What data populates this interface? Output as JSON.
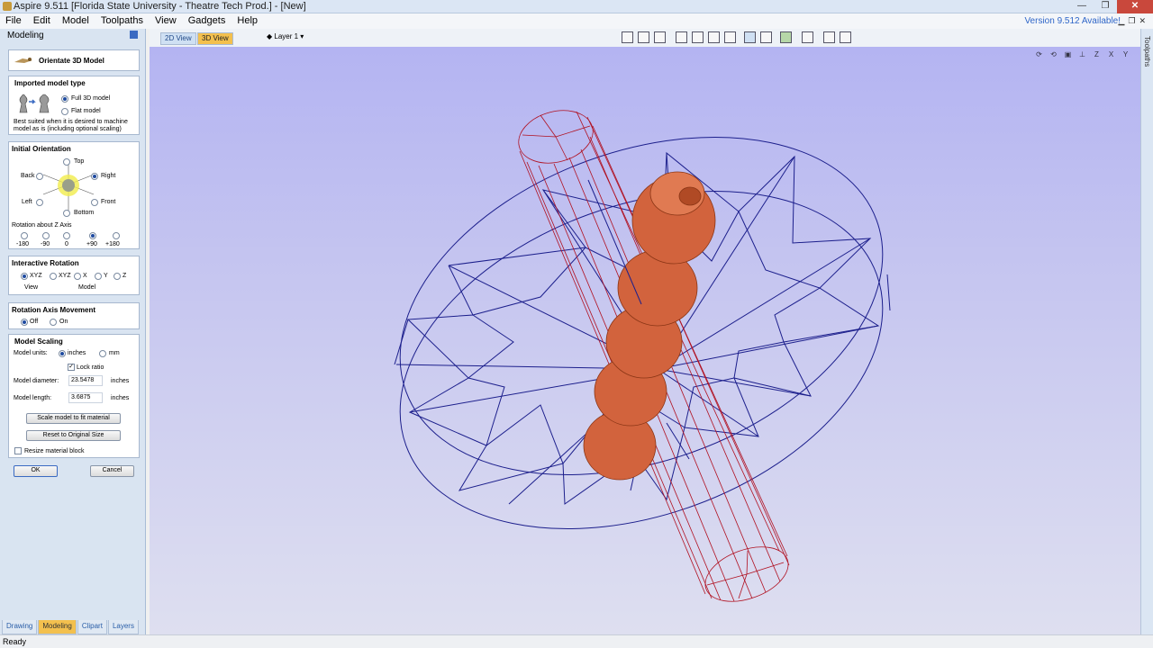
{
  "window": {
    "title": "Aspire 9.511 [Florida State University - Theatre Tech Prod.] - [New]"
  },
  "menu": {
    "items": [
      "File",
      "Edit",
      "Model",
      "Toolpaths",
      "View",
      "Gadgets",
      "Help"
    ],
    "version_notice": "Version 9.512 Available!"
  },
  "panel": {
    "header": "Modeling",
    "title": "Orientate 3D Model",
    "imported_type": {
      "title": "Imported model type",
      "full": "Full 3D model",
      "flat": "Flat model",
      "desc_line1": "Best suited when it is desired to machine",
      "desc_line2": "model as is (including optional scaling)"
    },
    "orientation": {
      "title": "Initial Orientation",
      "top": "Top",
      "back": "Back",
      "right": "Right",
      "left": "Left",
      "front": "Front",
      "bottom": "Bottom",
      "z_title": "Rotation about Z Axis",
      "z_values": [
        "-180",
        "-90",
        "0",
        "+90",
        "+180"
      ]
    },
    "interactive": {
      "title": "Interactive Rotation",
      "xyz_view": "XYZ",
      "xyz_model": "XYZ",
      "x": "X",
      "y": "Y",
      "z": "Z",
      "view_label": "View",
      "model_label": "Model"
    },
    "axis_movement": {
      "title": "Rotation Axis Movement",
      "off": "Off",
      "on": "On"
    },
    "scaling": {
      "title": "Model Scaling",
      "units_label": "Model units:",
      "inches": "inches",
      "mm": "mm",
      "lock": "Lock ratio",
      "diameter_label": "Model diameter:",
      "diameter_value": "23.5478",
      "diameter_unit": "inches",
      "length_label": "Model length:",
      "length_value": "3.6875",
      "length_unit": "inches",
      "scale_btn": "Scale model to fit material",
      "reset_btn": "Reset to Original Size",
      "resize": "Resize material block"
    },
    "ok": "OK",
    "cancel": "Cancel"
  },
  "bottom_tabs": [
    "Drawing",
    "Modeling",
    "Clipart",
    "Layers"
  ],
  "toolbar": {
    "tab_2d": "2D View",
    "tab_3d": "3D View",
    "layer": "Layer 1"
  },
  "right_strip": "Toolpaths",
  "status": "Ready",
  "colors": {
    "wire_blue": "#1c1f8c",
    "wire_red": "#b01020",
    "model_orange": "#d2633d",
    "active_tab": "#f3c04e"
  }
}
